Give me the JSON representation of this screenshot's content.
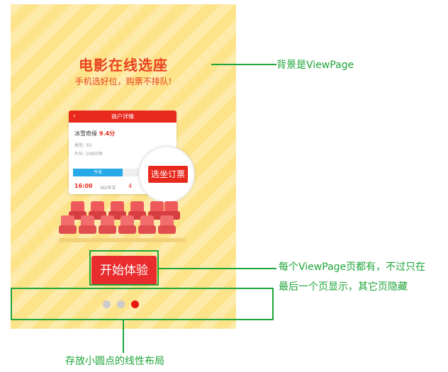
{
  "phone": {
    "headline": "电影在线选座",
    "subline": "手机选好位，购票不排队!",
    "card": {
      "back_icon": "‹",
      "title": "商户详情",
      "movie": "冰雪奇缘",
      "rating": "9.4分",
      "type_line": "类型: 3D",
      "duration_line": "片长: 108分钟",
      "tab_today": "今天",
      "tab_tomorrow": "明天",
      "time": "16:00",
      "format": "3D/中文",
      "extra": "4"
    },
    "select_seat_label": "选坐订票",
    "start_button_label": "开始体验",
    "page_indicator": {
      "total": 3,
      "active_index": 3
    }
  },
  "annotations": {
    "background": "背景是ViewPage",
    "button_line1": "每个ViewPage页都有，不过只在",
    "button_line2": "最后一个页显示，其它页隐藏",
    "dots": "存放小圆点的线性布局"
  },
  "colors": {
    "annotation_green": "#1fa539",
    "phone_background": "#fde38a",
    "accent_red": "#e92c2e",
    "active_dot": "#e8170d",
    "inactive_dot": "#cccccc"
  }
}
